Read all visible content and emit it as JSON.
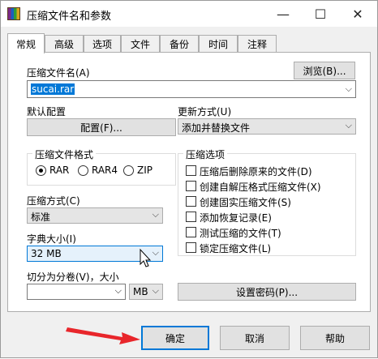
{
  "window": {
    "title": "压缩文件名和参数",
    "controls": {
      "minimize": "—",
      "maximize": "☐",
      "close": "✕"
    }
  },
  "tabs": [
    "常规",
    "高级",
    "选项",
    "文件",
    "备份",
    "时间",
    "注释"
  ],
  "general": {
    "archive_name_label": "压缩文件名(A)",
    "browse_button": "浏览(B)...",
    "archive_name_value": "sucai.rar",
    "default_profile_label": "默认配置",
    "profiles_button": "配置(F)...",
    "update_mode_label": "更新方式(U)",
    "update_mode_value": "添加并替换文件",
    "format_group_title": "压缩文件格式",
    "formats": [
      "RAR",
      "RAR4",
      "ZIP"
    ],
    "selected_format": "RAR",
    "options_group_title": "压缩选项",
    "options": [
      "压缩后删除原来的文件(D)",
      "创建自解压格式压缩文件(X)",
      "创建固实压缩文件(S)",
      "添加恢复记录(E)",
      "测试压缩的文件(T)",
      "锁定压缩文件(L)"
    ],
    "method_label": "压缩方式(C)",
    "method_value": "标准",
    "dict_label": "字典大小(I)",
    "dict_value": "32 MB",
    "split_label": "切分为分卷(V)，大小",
    "split_value": "",
    "split_unit": "MB",
    "password_button": "设置密码(P)..."
  },
  "footer": {
    "ok": "确定",
    "cancel": "取消",
    "help": "帮助"
  },
  "colors": {
    "accent": "#0078d7",
    "annotation_arrow": "#e8262b"
  }
}
